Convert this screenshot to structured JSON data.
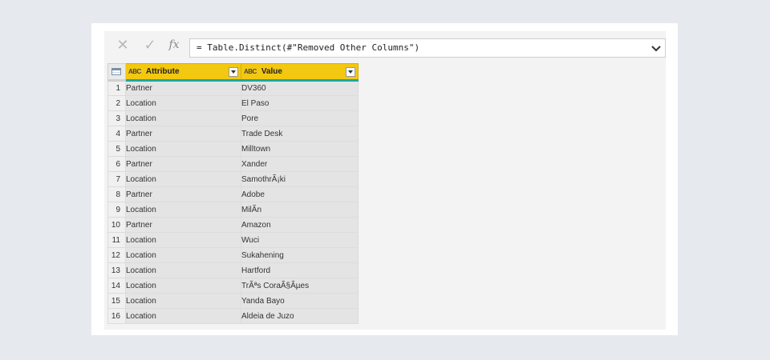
{
  "formula_bar": {
    "cancel_glyph": "✕",
    "commit_glyph": "✓",
    "fx_label": "fx",
    "formula": "= Table.Distinct(#\"Removed Other Columns\")"
  },
  "columns": [
    {
      "type_icon": "ABC",
      "name": "Attribute"
    },
    {
      "type_icon": "ABC",
      "name": "Value"
    }
  ],
  "rows": [
    {
      "n": "1",
      "attribute": "Partner",
      "value": "DV360"
    },
    {
      "n": "2",
      "attribute": "Location",
      "value": "El Paso"
    },
    {
      "n": "3",
      "attribute": "Location",
      "value": "Pore"
    },
    {
      "n": "4",
      "attribute": "Partner",
      "value": "Trade Desk"
    },
    {
      "n": "5",
      "attribute": "Location",
      "value": "Milltown"
    },
    {
      "n": "6",
      "attribute": "Partner",
      "value": "Xander"
    },
    {
      "n": "7",
      "attribute": "Location",
      "value": "SamothrÃ¡ki"
    },
    {
      "n": "8",
      "attribute": "Partner",
      "value": "Adobe"
    },
    {
      "n": "9",
      "attribute": "Location",
      "value": "MilÃ­n"
    },
    {
      "n": "10",
      "attribute": "Partner",
      "value": "Amazon"
    },
    {
      "n": "11",
      "attribute": "Location",
      "value": "Wuci"
    },
    {
      "n": "12",
      "attribute": "Location",
      "value": "Sukahening"
    },
    {
      "n": "13",
      "attribute": "Location",
      "value": "Hartford"
    },
    {
      "n": "14",
      "attribute": "Location",
      "value": "TrÃªs CoraÃ§Ãµes"
    },
    {
      "n": "15",
      "attribute": "Location",
      "value": "Yanda Bayo"
    },
    {
      "n": "16",
      "attribute": "Location",
      "value": "Aldeia de Juzo"
    }
  ],
  "colors": {
    "header_bg": "#f2c811",
    "header_underline": "#1fa8a0",
    "cell_bg": "#e4e4e4",
    "page_bg": "#e6eaee"
  }
}
